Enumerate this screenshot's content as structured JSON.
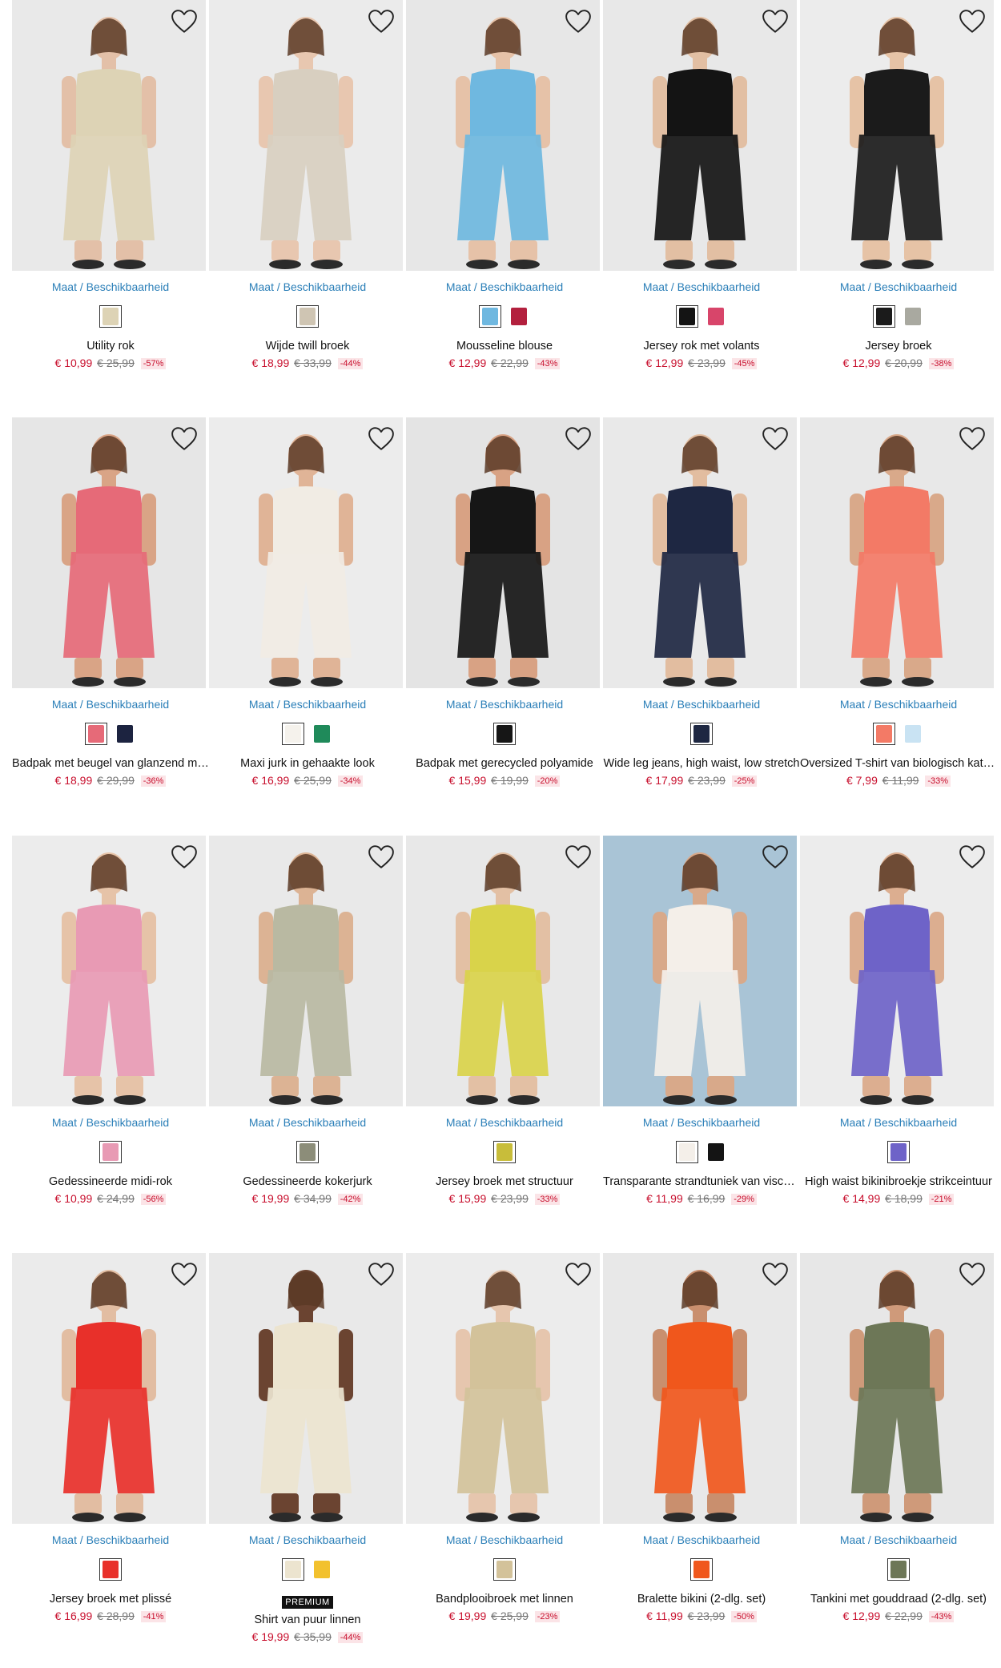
{
  "common": {
    "size_link_label": "Maat / Beschikbaarheid",
    "premium_badge": "PREMIUM"
  },
  "colors": {
    "price_red": "#c8102e",
    "link_blue": "#2b7fb8",
    "discount_bg": "#fbe4e7"
  },
  "products": [
    {
      "name": "Utility rok",
      "price": "€ 10,99",
      "old_price": "€ 25,99",
      "discount": "-57%",
      "bg": "#e9e9e9",
      "garment": "#ddd3b5",
      "skin": "#e3c0a8",
      "swatches": [
        "#ddd3b5"
      ]
    },
    {
      "name": "Wijde twill broek",
      "price": "€ 18,99",
      "old_price": "€ 33,99",
      "discount": "-44%",
      "bg": "#ebebeb",
      "garment": "#d8cfc0",
      "skin": "#e8c7b0",
      "swatches": [
        "#cfc5b3"
      ]
    },
    {
      "name": "Mousseline blouse",
      "price": "€ 12,99",
      "old_price": "€ 22,99",
      "discount": "-43%",
      "bg": "#e7e7e7",
      "garment": "#6fb8e0",
      "skin": "#e6c2a8",
      "swatches": [
        "#6fb8e0",
        "#b3203e"
      ]
    },
    {
      "name": "Jersey rok met volants",
      "price": "€ 12,99",
      "old_price": "€ 23,99",
      "discount": "-45%",
      "bg": "#e8e8e8",
      "garment": "#141414",
      "skin": "#e2bfa3",
      "swatches": [
        "#141414",
        "#d8456a"
      ]
    },
    {
      "name": "Jersey broek",
      "price": "€ 12,99",
      "old_price": "€ 20,99",
      "discount": "-38%",
      "bg": "#ececec",
      "garment": "#1b1b1b",
      "skin": "#e6c3a6",
      "swatches": [
        "#1b1b1b",
        "#a9a9a0"
      ]
    },
    {
      "name": "Badpak met beugel van glanzend materiaal",
      "price": "€ 18,99",
      "old_price": "€ 29,99",
      "discount": "-36%",
      "bg": "#e6e6e6",
      "garment": "#e66a78",
      "skin": "#d9a486",
      "swatches": [
        "#e66a78",
        "#1c2340"
      ]
    },
    {
      "name": "Maxi jurk in gehaakte look",
      "price": "€ 16,99",
      "old_price": "€ 25,99",
      "discount": "-34%",
      "bg": "#ececec",
      "garment": "#f1ece4",
      "skin": "#e0b497",
      "swatches": [
        "#f5f2ec",
        "#1f8a5a"
      ]
    },
    {
      "name": "Badpak met gerecycled polyamide",
      "price": "€ 15,99",
      "old_price": "€ 19,99",
      "discount": "-20%",
      "bg": "#e4e4e4",
      "garment": "#161616",
      "skin": "#d8a284",
      "swatches": [
        "#161616"
      ]
    },
    {
      "name": "Wide leg jeans, high waist, low stretch",
      "price": "€ 17,99",
      "old_price": "€ 23,99",
      "discount": "-25%",
      "bg": "#e9e9e9",
      "garment": "#1e2742",
      "skin": "#e2bda0",
      "swatches": [
        "#1e2742"
      ]
    },
    {
      "name": "Oversized T-shirt van biologisch katoen",
      "price": "€ 7,99",
      "old_price": "€ 11,99",
      "discount": "-33%",
      "bg": "#e8e8e8",
      "garment": "#f37a66",
      "skin": "#d9a98a",
      "swatches": [
        "#f37a66",
        "#c9e3f3"
      ]
    },
    {
      "name": "Gedessineerde midi-rok",
      "price": "€ 10,99",
      "old_price": "€ 24,99",
      "discount": "-56%",
      "bg": "#ececec",
      "garment": "#e89ab4",
      "skin": "#e6c3a8",
      "swatches": [
        "#e89ab4"
      ]
    },
    {
      "name": "Gedessineerde kokerjurk",
      "price": "€ 19,99",
      "old_price": "€ 34,99",
      "discount": "-42%",
      "bg": "#e9e9e9",
      "garment": "#b9b9a2",
      "skin": "#dcb394",
      "swatches": [
        "#8c8d79"
      ]
    },
    {
      "name": "Jersey broek met structuur",
      "price": "€ 15,99",
      "old_price": "€ 23,99",
      "discount": "-33%",
      "bg": "#e8e8e8",
      "garment": "#d9d34a",
      "skin": "#e3c0a4",
      "swatches": [
        "#c8bd3a"
      ]
    },
    {
      "name": "Transparante strandtuniek van viscose",
      "price": "€ 11,99",
      "old_price": "€ 16,99",
      "discount": "-29%",
      "bg": "#a9c4d6",
      "garment": "#f4efe9",
      "skin": "#d8a98a",
      "swatches": [
        "#f4efe9",
        "#141414"
      ]
    },
    {
      "name": "High waist bikinibroekje strikceintuur",
      "price": "€ 14,99",
      "old_price": "€ 18,99",
      "discount": "-21%",
      "bg": "#ececec",
      "garment": "#6e63c8",
      "skin": "#dcae90",
      "swatches": [
        "#6e63c8"
      ]
    },
    {
      "name": "Jersey broek met plissé",
      "price": "€ 16,99",
      "old_price": "€ 28,99",
      "discount": "-41%",
      "bg": "#ebebeb",
      "garment": "#e8302a",
      "skin": "#e2bda2",
      "swatches": [
        "#e8302a"
      ]
    },
    {
      "name": "Shirt van puur linnen",
      "price": "€ 19,99",
      "old_price": "€ 35,99",
      "discount": "-44%",
      "bg": "#e9e9e9",
      "garment": "#ece4cf",
      "skin": "#6b4431",
      "swatches": [
        "#ece4cf",
        "#f2c12e"
      ],
      "premium": true
    },
    {
      "name": "Bandplooibroek met linnen",
      "price": "€ 19,99",
      "old_price": "€ 25,99",
      "discount": "-23%",
      "bg": "#ececec",
      "garment": "#d3c29a",
      "skin": "#e6c6ae",
      "swatches": [
        "#d3c29a"
      ]
    },
    {
      "name": "Bralette bikini (2-dlg. set)",
      "price": "€ 11,99",
      "old_price": "€ 23,99",
      "discount": "-50%",
      "bg": "#e8e8e8",
      "garment": "#f0571c",
      "skin": "#c98f6e",
      "swatches": [
        "#f0571c"
      ]
    },
    {
      "name": "Tankini met gouddraad (2-dlg. set)",
      "price": "€ 12,99",
      "old_price": "€ 22,99",
      "discount": "-43%",
      "bg": "#e7e7e7",
      "garment": "#6d7757",
      "skin": "#cf9a7a",
      "swatches": [
        "#6d7757"
      ]
    }
  ]
}
